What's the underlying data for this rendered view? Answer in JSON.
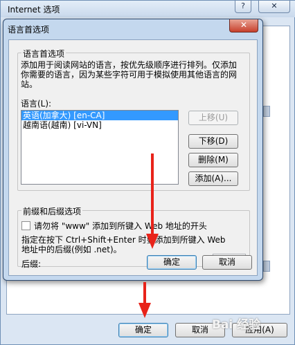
{
  "back_window": {
    "title": "Internet 选项",
    "help_button": "?",
    "close_button": "✕",
    "ok_button": "确定",
    "cancel_button": "取消",
    "apply_button": "应用(A)"
  },
  "dialog": {
    "title": "语言首选项",
    "close_button": "✕",
    "language_group": {
      "label": "语言首选项",
      "description": [
        "添加用于阅读网站的语言，按优先级顺序进行排列。仅添加",
        "你需要的语言，因为某些字符可用于模拟使用其他语言的网",
        "站。"
      ],
      "list_label": "语言(L):",
      "languages": [
        {
          "name": "英语(加拿大) [en-CA]",
          "selected": true
        },
        {
          "name": "越南语(越南) [vi-VN]",
          "selected": false
        }
      ],
      "move_up_button": "上移(U)",
      "move_down_button": "下移(D)",
      "remove_button": "删除(M)",
      "add_button": "添加(A)..."
    },
    "prefix_suffix_group": {
      "label": "前缀和后缀选项",
      "checkbox_label": "请勿将 \"www\" 添加到所键入 Web 地址的开头",
      "checkbox_checked": false,
      "hint": [
        "指定在按下 Ctrl+Shift+Enter 时要添加到所键入 Web",
        "地址中的后缀(例如 .net)。"
      ],
      "suffix_label": "后缀:",
      "suffix_dot": ".",
      "suffix_value": ""
    },
    "ok_button": "确定",
    "cancel_button": "取消"
  },
  "annotation": {
    "arrow_color": "#e8231a",
    "watermark": "Bai 经验"
  }
}
